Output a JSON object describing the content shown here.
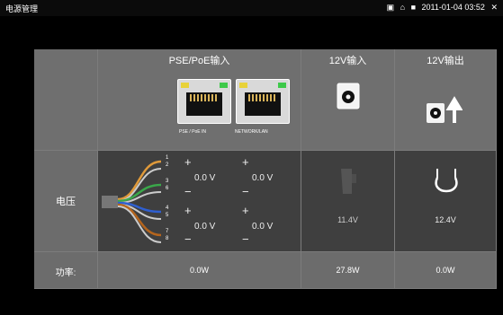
{
  "statusbar": {
    "title": "电源管理",
    "datetime": "2011-01-04 03:52"
  },
  "table": {
    "headers": {
      "pse_poe": "PSE/PoE输入",
      "v12_in": "12V输入",
      "v12_out": "12V输出"
    },
    "ports": {
      "port1_label": "PSE / PoE IN",
      "port2_label": "NETWORK/LAN"
    },
    "voltage_row": {
      "label": "电压",
      "wire_numbers": [
        "1",
        "2",
        "3",
        "6",
        "4",
        "5",
        "7",
        "8"
      ],
      "pairs": [
        {
          "plus": "+",
          "minus": "−",
          "value": "0.0 V"
        },
        {
          "plus": "+",
          "minus": "−",
          "value": "0.0 V"
        },
        {
          "plus": "+",
          "minus": "−",
          "value": "0.0 V"
        },
        {
          "plus": "+",
          "minus": "−",
          "value": "0.0 V"
        }
      ],
      "v12_in_value": "11.4V",
      "v12_out_value": "12.4V"
    },
    "power_row": {
      "label": "功率:",
      "poe_value": "0.0W",
      "v12_in_value": "27.8W",
      "v12_out_value": "0.0W"
    }
  },
  "colors": {
    "screen_bg": "#000000",
    "panel_dark": "#3f3f3f",
    "panel_light": "#6c6c6c",
    "led_yellow": "#e8d23a",
    "led_green": "#3ec94a"
  }
}
